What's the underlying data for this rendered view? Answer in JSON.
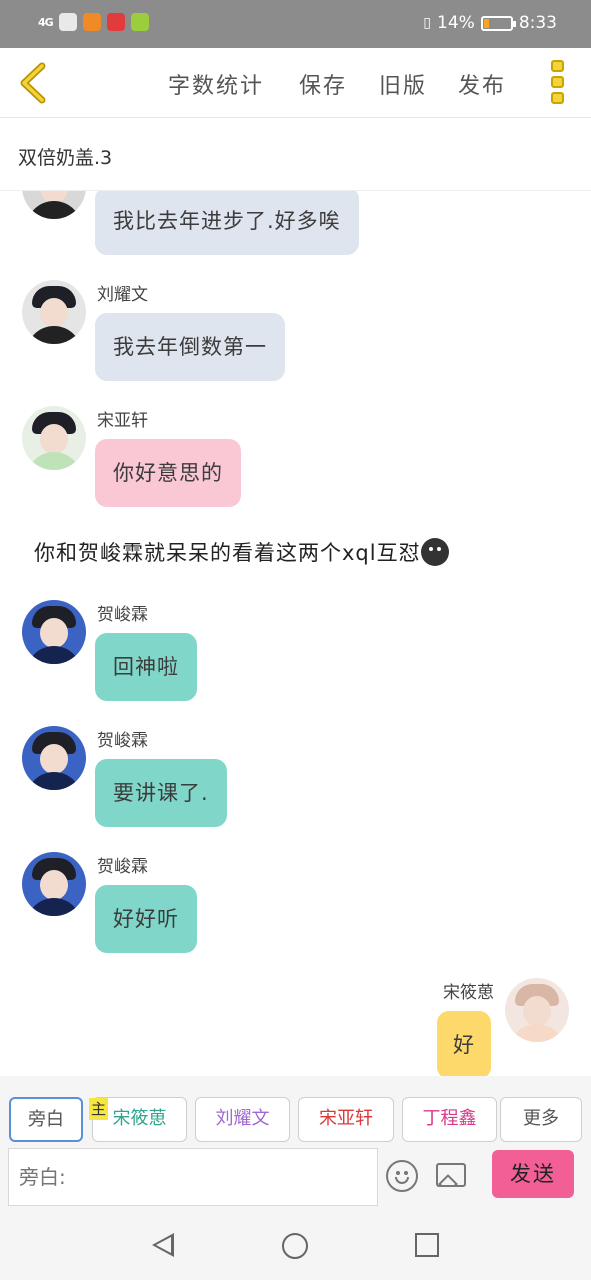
{
  "status_bar": {
    "signal": "4G",
    "battery": "14%",
    "time": "8:33"
  },
  "header": {
    "nav_items": [
      "字数统计",
      "保存",
      "旧版",
      "发布"
    ]
  },
  "title": "双倍奶盖.3",
  "messages": [
    {
      "type": "left",
      "name": "",
      "text": "我比去年进步了.好多唉",
      "style": "gray"
    },
    {
      "type": "left",
      "name": "刘耀文",
      "text": "我去年倒数第一",
      "style": "gray"
    },
    {
      "type": "left",
      "name": "宋亚轩",
      "text": "你好意思的",
      "style": "pink"
    },
    {
      "type": "narration",
      "text": "你和贺峻霖就呆呆的看着这两个xql互怼"
    },
    {
      "type": "left",
      "name": "贺峻霖",
      "text": "回神啦",
      "style": "teal"
    },
    {
      "type": "left",
      "name": "贺峻霖",
      "text": "要讲课了.",
      "style": "teal"
    },
    {
      "type": "left",
      "name": "贺峻霖",
      "text": "好好听",
      "style": "teal"
    },
    {
      "type": "right",
      "name": "宋筱葸",
      "text": "好",
      "style": "yellow"
    }
  ],
  "roles": {
    "main_badge": "主",
    "items": [
      "旁白",
      "宋筱葸",
      "刘耀文",
      "宋亚轩",
      "丁程鑫",
      "更多"
    ]
  },
  "input": {
    "placeholder": "旁白:",
    "send_label": "发送"
  },
  "colors": {
    "accent_pink": "#f25f96",
    "teal_bubble": "#7fd6c9",
    "gray_bubble": "#dfe5ee",
    "pink_bubble": "#f9c8d4",
    "yellow_bubble": "#fcd96a"
  }
}
